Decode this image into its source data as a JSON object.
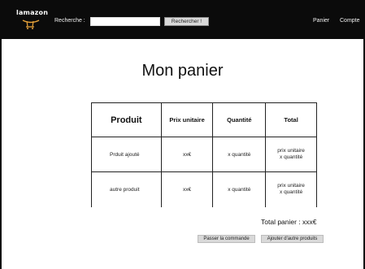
{
  "header": {
    "logo_text": "lamazon",
    "search_label": "Recherche :",
    "search_value": "",
    "search_button": "Rechercher !",
    "nav": {
      "cart": "Panier",
      "account": "Compte"
    }
  },
  "main": {
    "title": "Mon panier",
    "table": {
      "headers": {
        "product": "Produit",
        "unit_price": "Prix unitaire",
        "quantity": "Quantité",
        "total": "Total"
      },
      "rows": [
        {
          "product": "Prduit ajouté",
          "unit_price": "xx€",
          "quantity": "x quantité",
          "total_line1": "prix unitaire",
          "total_line2": "x quantité"
        },
        {
          "product": "autre produit",
          "unit_price": "xx€",
          "quantity": "x quantité",
          "total_line1": "prix unitaire",
          "total_line2": "x quantité"
        }
      ]
    },
    "total_label": "Total panier : xxx€",
    "buttons": {
      "order": "Passer la commande",
      "add_more": "Ajouter d'autre produits"
    }
  },
  "colors": {
    "header_bg": "#0b0b0b",
    "button_bg": "#d9d9d9",
    "logo_accent": "#e8a33a"
  }
}
